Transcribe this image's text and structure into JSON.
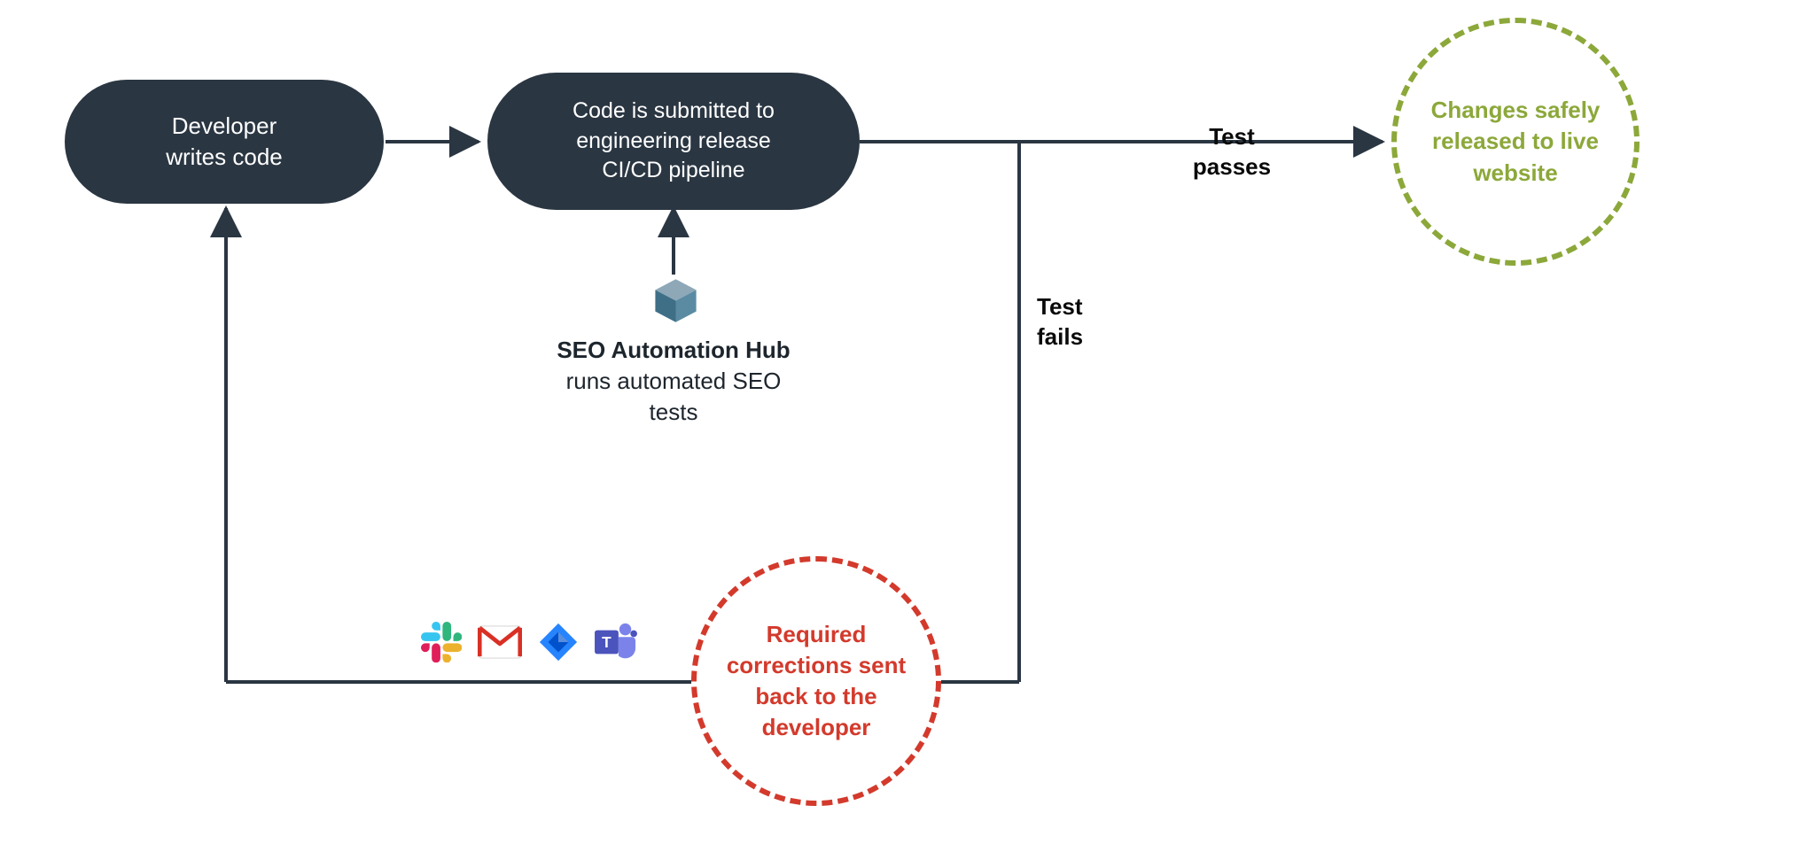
{
  "nodes": {
    "developer_writes_code": "Developer\nwrites code",
    "code_submitted": "Code is submitted to\nengineering release\nCI/CD pipeline",
    "seo_hub_bold": "SEO Automation Hub",
    "seo_hub_rest": "runs automated SEO\ntests",
    "changes_released": "Changes safely\nreleased to live\nwebsite",
    "required_corrections": "Required\ncorrections sent\nback to the\ndeveloper"
  },
  "edge_labels": {
    "test_passes": "Test\npasses",
    "test_fails": "Test\nfails"
  },
  "colors": {
    "pill_bg": "#2a3642",
    "stroke": "#2a3642",
    "green": "#8ca83a",
    "red": "#d33a2c"
  },
  "icons": {
    "slack": "slack-icon",
    "gmail": "gmail-icon",
    "jira": "jira-icon",
    "teams": "teams-icon",
    "cube": "cube-icon"
  }
}
